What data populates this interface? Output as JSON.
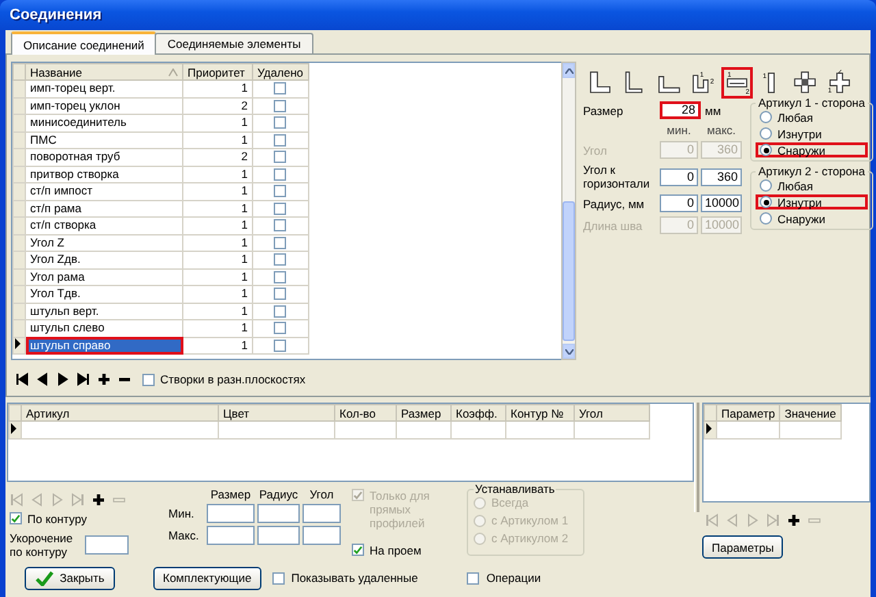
{
  "window": {
    "title": "Соединения"
  },
  "tabs": [
    {
      "label": "Описание соединений",
      "selected": true
    },
    {
      "label": "Соединяемые элементы",
      "selected": false
    }
  ],
  "connections": {
    "columns": [
      {
        "label": "Название",
        "sorted": true
      },
      {
        "label": "Приоритет",
        "sorted": false
      },
      {
        "label": "Удалено",
        "sorted": false
      }
    ],
    "rows": [
      {
        "name": "имп-торец верт.",
        "priority": "1",
        "deleted": false,
        "selected": false,
        "highlighted": false
      },
      {
        "name": "имп-торец уклон",
        "priority": "2",
        "deleted": false,
        "selected": false,
        "highlighted": false
      },
      {
        "name": "минисоединитель",
        "priority": "1",
        "deleted": false,
        "selected": false,
        "highlighted": false
      },
      {
        "name": "ПМС",
        "priority": "1",
        "deleted": false,
        "selected": false,
        "highlighted": false
      },
      {
        "name": "поворотная труб",
        "priority": "2",
        "deleted": false,
        "selected": false,
        "highlighted": false
      },
      {
        "name": "притвор створка",
        "priority": "1",
        "deleted": false,
        "selected": false,
        "highlighted": false
      },
      {
        "name": "ст/п импост",
        "priority": "1",
        "deleted": false,
        "selected": false,
        "highlighted": false
      },
      {
        "name": "ст/п рама",
        "priority": "1",
        "deleted": false,
        "selected": false,
        "highlighted": false
      },
      {
        "name": "ст/п створка",
        "priority": "1",
        "deleted": false,
        "selected": false,
        "highlighted": false
      },
      {
        "name": "Угол Z",
        "priority": "1",
        "deleted": false,
        "selected": false,
        "highlighted": false
      },
      {
        "name": "Угол Zдв.",
        "priority": "1",
        "deleted": false,
        "selected": false,
        "highlighted": false
      },
      {
        "name": "Угол рама",
        "priority": "1",
        "deleted": false,
        "selected": false,
        "highlighted": false
      },
      {
        "name": "Угол Тдв.",
        "priority": "1",
        "deleted": false,
        "selected": false,
        "highlighted": false
      },
      {
        "name": "штульп верт.",
        "priority": "1",
        "deleted": false,
        "selected": false,
        "highlighted": false
      },
      {
        "name": "штульп слево",
        "priority": "1",
        "deleted": false,
        "selected": false,
        "highlighted": false
      },
      {
        "name": "штульп справо",
        "priority": "1",
        "deleted": false,
        "selected": true,
        "highlighted": true
      }
    ],
    "navigator": [
      {
        "kind": "first",
        "disabled": false
      },
      {
        "kind": "prev",
        "disabled": false
      },
      {
        "kind": "next",
        "disabled": false
      },
      {
        "kind": "last",
        "disabled": false
      },
      {
        "kind": "add",
        "disabled": false
      },
      {
        "kind": "remove",
        "disabled": false
      }
    ],
    "planes_checkbox": {
      "label": "Створки в разн.плоскостях",
      "checked": false
    }
  },
  "profile_types": [
    {
      "kind": "l-thick",
      "highlighted": false
    },
    {
      "kind": "l-narrow",
      "highlighted": false
    },
    {
      "kind": "l-short",
      "highlighted": false
    },
    {
      "kind": "l-step",
      "marks": [
        "1",
        "2"
      ],
      "highlighted": false
    },
    {
      "kind": "flat",
      "marks": [
        "1",
        "2"
      ],
      "highlighted": true
    },
    {
      "kind": "bar",
      "marks": [
        "1"
      ],
      "highlighted": false
    },
    {
      "kind": "cross",
      "highlighted": false
    },
    {
      "kind": "cross-offset",
      "marks": [
        "2",
        "1"
      ],
      "highlighted": false
    }
  ],
  "size": {
    "label": "Размер",
    "value": "28",
    "unit": "мм",
    "highlighted": true
  },
  "limits": {
    "min_label": "мин.",
    "max_label": "макс.",
    "rows": [
      {
        "label": "Угол",
        "min": "0",
        "max": "360",
        "disabled": true
      },
      {
        "label": "Угол к горизонтали",
        "min": "0",
        "max": "360",
        "disabled": false
      },
      {
        "label": "Радиус, мм",
        "min": "0",
        "max": "10000",
        "disabled": false
      },
      {
        "label": "Длина шва",
        "min": "0",
        "max": "10000",
        "disabled": true
      }
    ]
  },
  "side_groups": [
    {
      "title": "Артикул 1 - сторона",
      "options": [
        {
          "label": "Любая",
          "selected": false,
          "highlighted": false
        },
        {
          "label": "Изнутри",
          "selected": false,
          "highlighted": false
        },
        {
          "label": "Снаружи",
          "selected": true,
          "highlighted": true
        }
      ]
    },
    {
      "title": "Артикул 2 - сторона",
      "options": [
        {
          "label": "Любая",
          "selected": false,
          "highlighted": false
        },
        {
          "label": "Изнутри",
          "selected": true,
          "highlighted": true
        },
        {
          "label": "Снаружи",
          "selected": false,
          "highlighted": false
        }
      ]
    }
  ],
  "components": {
    "columns": [
      "Артикул",
      "Цвет",
      "Кол-во",
      "Размер",
      "Коэфф.",
      "Контур №",
      "Угол"
    ],
    "rows": [
      {
        "current": true
      }
    ],
    "navigator": [
      {
        "kind": "first",
        "disabled": true
      },
      {
        "kind": "prev",
        "disabled": true
      },
      {
        "kind": "next",
        "disabled": true
      },
      {
        "kind": "last",
        "disabled": true
      },
      {
        "kind": "add",
        "disabled": false
      },
      {
        "kind": "remove",
        "disabled": true
      }
    ],
    "range": {
      "columns": [
        "Размер",
        "Радиус",
        "Угол"
      ],
      "rows": [
        "Мин.",
        "Макс."
      ]
    },
    "by_contour": {
      "label": "По контуру",
      "checked": true,
      "disabled": false
    },
    "shortening": {
      "label": "Укорочение по контуру"
    },
    "only_straight": {
      "label": "Только для прямых профилей",
      "checked": true,
      "disabled": true
    },
    "on_opening": {
      "label": "На проем",
      "checked": true,
      "disabled": false
    },
    "install": {
      "title": "Устанавливать",
      "disabled": true,
      "options": [
        {
          "label": "Всегда",
          "selected": false
        },
        {
          "label": "с Артикулом 1",
          "selected": false
        },
        {
          "label": "с Артикулом 2",
          "selected": false
        }
      ]
    }
  },
  "parameters": {
    "columns": [
      "Параметр",
      "Значение"
    ],
    "rows": [
      {
        "current": true
      }
    ],
    "navigator": [
      {
        "kind": "first",
        "disabled": true
      },
      {
        "kind": "prev",
        "disabled": true
      },
      {
        "kind": "next",
        "disabled": true
      },
      {
        "kind": "last",
        "disabled": true
      },
      {
        "kind": "add",
        "disabled": false
      },
      {
        "kind": "remove",
        "disabled": true
      }
    ],
    "button": "Параметры"
  },
  "footer": {
    "buttons": [
      {
        "label": "Закрыть",
        "kind": "confirm"
      },
      {
        "label": "Комплектующие",
        "kind": "plain"
      }
    ],
    "checkboxes": [
      {
        "label": "Показывать удаленные",
        "checked": false
      },
      {
        "label": "Операции",
        "checked": false
      }
    ]
  }
}
